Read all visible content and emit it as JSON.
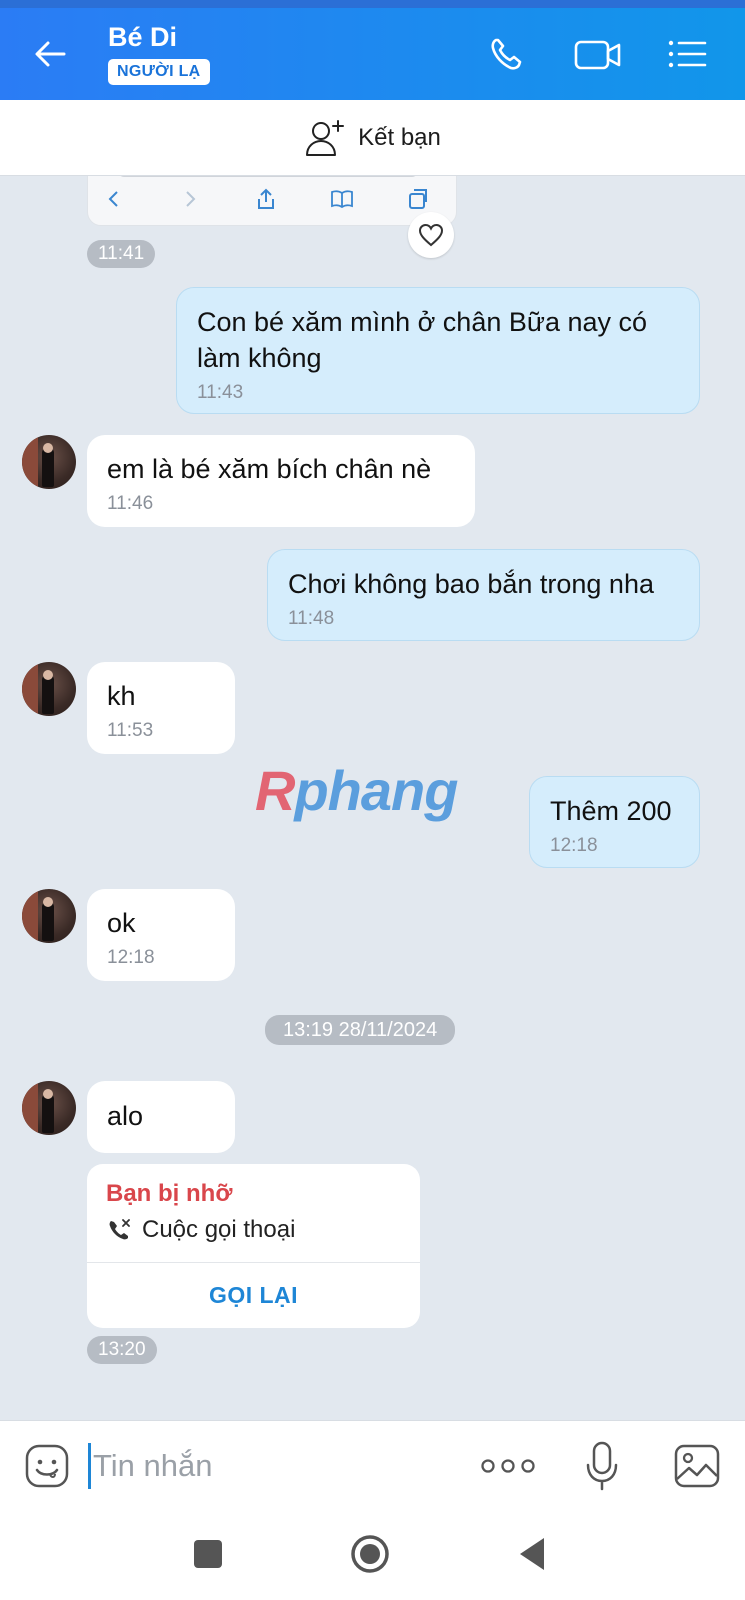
{
  "header": {
    "contact_name": "Bé Di",
    "badge": "NGƯỜI LẠ",
    "icons": [
      "back-arrow-icon",
      "phone-icon",
      "video-camera-icon",
      "menu-list-icon"
    ]
  },
  "add_friend": {
    "label": "Kết bạn",
    "icon": "add-person-icon"
  },
  "messages": [
    {
      "dir": "time",
      "text": "11:41"
    },
    {
      "dir": "out",
      "text": "Con bé xăm mình ở chân Bữa nay có làm không",
      "time": "11:43"
    },
    {
      "dir": "in",
      "text": "em là bé xăm bích chân nè",
      "time": "11:46"
    },
    {
      "dir": "out",
      "text": "Chơi không bao bắn trong nha",
      "time": "11:48"
    },
    {
      "dir": "in",
      "text": "kh",
      "time": "11:53"
    },
    {
      "dir": "out",
      "text": "Thêm 200",
      "time": "12:18"
    },
    {
      "dir": "in",
      "text": "ok",
      "time": "12:18"
    },
    {
      "dir": "date",
      "text": "13:19 28/11/2024"
    },
    {
      "dir": "in",
      "text": "alo"
    }
  ],
  "watermark": {
    "part1": "R",
    "part2": "phang"
  },
  "missed_call": {
    "title": "Bạn bị nhỡ",
    "type": "Cuộc gọi thoại",
    "action": "GỌI LẠI",
    "time": "13:20"
  },
  "input": {
    "placeholder": "Tin nhắn"
  },
  "colors": {
    "header": "#1a8cf0",
    "outgoing_bubble": "#d5edfc",
    "missed": "#d9464b",
    "accent": "#1e86d6"
  }
}
